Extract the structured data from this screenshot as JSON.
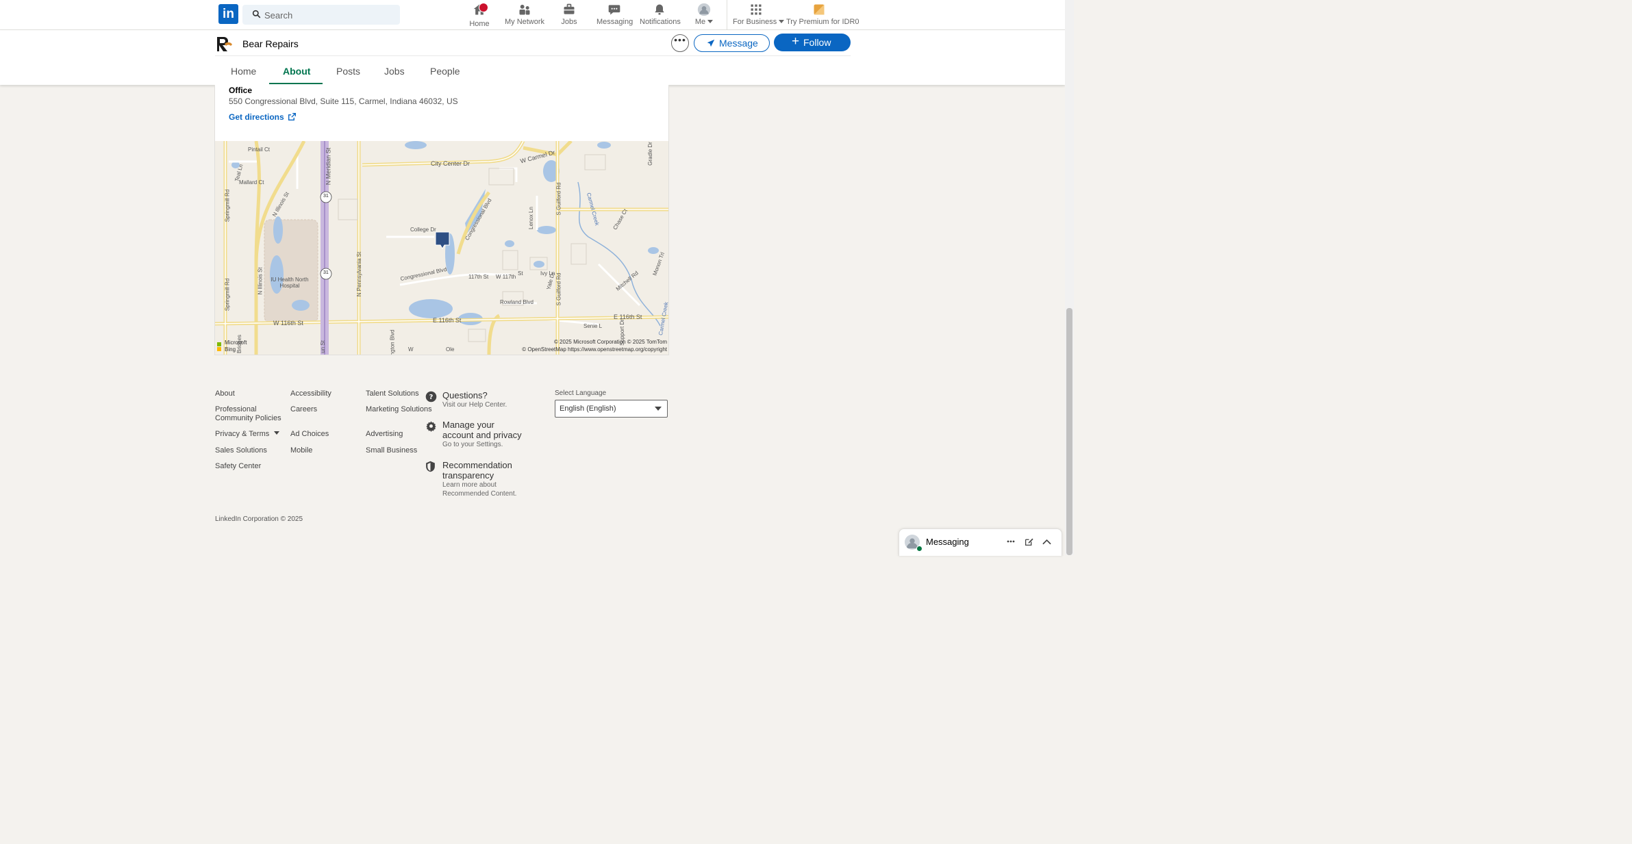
{
  "topnav": {
    "search_placeholder": "Search",
    "items": [
      {
        "label": "Home"
      },
      {
        "label": "My Network"
      },
      {
        "label": "Jobs"
      },
      {
        "label": "Messaging"
      },
      {
        "label": "Notifications"
      },
      {
        "label": "Me"
      },
      {
        "label": "For Business"
      },
      {
        "label": "Try Premium for IDR0"
      }
    ]
  },
  "company": {
    "name": "Bear Repairs",
    "message_label": "Message",
    "follow_label": "Follow",
    "tabs": [
      "Home",
      "About",
      "Posts",
      "Jobs",
      "People"
    ],
    "active_tab": "About"
  },
  "location": {
    "label": "Office",
    "address": "550 Congressional Blvd, Suite 115, Carmel, Indiana 46032, US",
    "directions_label": "Get directions"
  },
  "map": {
    "labels": {
      "pintail": "Pintail Ct",
      "city_center": "City Center Dr",
      "w_carmel": "W Carmel Dr",
      "teal": "Teal Ln",
      "mallard": "Mallard Ct",
      "springmill_top": "Springmill Rd",
      "springmill_bottom": "Springmill Rd",
      "n_meridian": "N Meridian St",
      "n_illinois_top": "N Illinois St",
      "n_illinois_bottom": "N Illinois St",
      "route_31_top": "31",
      "route_31_bottom": "31",
      "college": "College Dr",
      "congressional_top": "Congressional Blvd",
      "congressional_bottom": "Congressional Blvd",
      "lenox": "Lenox Ln",
      "s_guilford_top": "S Guilford Rd",
      "s_guilford_bottom": "S Guilford Rd",
      "carmel_creek_top": "Carmel Creek",
      "carmel_creek_bottom": "Carmel Creek",
      "chase": "Chase Ct",
      "gradle": "Gradle Dr",
      "monon": "Monon Trl",
      "mitchell": "Mitchell Rd",
      "n_pennsylvania": "N Pennsylvania St",
      "w_117th": "117th St",
      "w_117th_b": "W 117th",
      "st": "St",
      "ivy": "Ivy Ln",
      "yale": "Yale Dr",
      "rowland": "Rowland Blvd",
      "hospital": "IU Health North Hospital",
      "w_116th": "W 116th St",
      "e_116th": "E.116th St",
      "e_116th_right": "E 116th St",
      "senie": "Senie L",
      "bridges": "Bridges",
      "meridian_bottom": "un St",
      "lexington": "ngton Blvd",
      "w": "W",
      "ole": "Ole",
      "support": "Support Dr"
    },
    "attribution_1": "© 2025 Microsoft Corporation © 2025 TomTom",
    "attribution_2": "© OpenStreetMap https://www.openstreetmap.org/copyright",
    "bing_1": "Microsoft",
    "bing_2": "Bing"
  },
  "footer": {
    "col1": [
      "About",
      "Professional Community Policies",
      "Privacy & Terms",
      "Sales Solutions",
      "Safety Center"
    ],
    "col2": [
      "Accessibility",
      "Careers",
      "Ad Choices",
      "Mobile"
    ],
    "col3": [
      "Talent Solutions",
      "Marketing Solutions",
      "Advertising",
      "Small Business"
    ],
    "help": [
      {
        "title": "Questions?",
        "sub": "Visit our Help Center."
      },
      {
        "title": "Manage your account and privacy",
        "sub": "Go to your Settings."
      },
      {
        "title": "Recommendation transparency",
        "sub": "Learn more about Recommended Content."
      }
    ],
    "language_label": "Select Language",
    "language_value": "English (English)",
    "copyright": "LinkedIn Corporation © 2025"
  },
  "messaging": {
    "title": "Messaging"
  },
  "colors": {
    "brand": "#0a66c2",
    "active_tab": "#01754f",
    "notification_badge": "#cb112d"
  }
}
